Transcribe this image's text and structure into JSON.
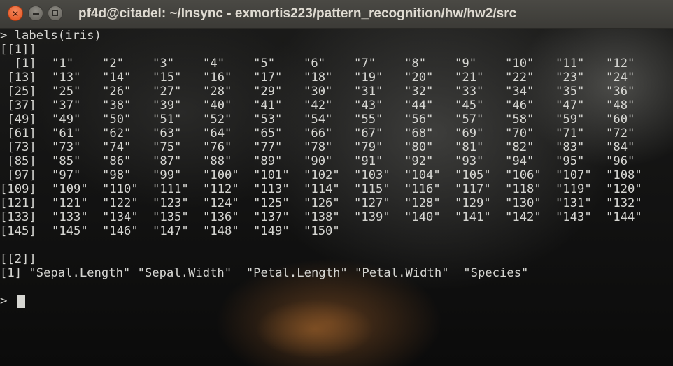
{
  "window": {
    "title": "pf4d@citadel: ~/Insync - exmortis223/pattern_recognition/hw/hw2/src",
    "close_glyph": "✕"
  },
  "terminal": {
    "command_line": "> labels(iris)",
    "section1_header": "[[1]]",
    "rows": [
      [
        "  [1]",
        "\"1\"",
        "\"2\"",
        "\"3\"",
        "\"4\"",
        "\"5\"",
        "\"6\"",
        "\"7\"",
        "\"8\"",
        "\"9\"",
        "\"10\"",
        "\"11\"",
        "\"12\""
      ],
      [
        " [13]",
        "\"13\"",
        "\"14\"",
        "\"15\"",
        "\"16\"",
        "\"17\"",
        "\"18\"",
        "\"19\"",
        "\"20\"",
        "\"21\"",
        "\"22\"",
        "\"23\"",
        "\"24\""
      ],
      [
        " [25]",
        "\"25\"",
        "\"26\"",
        "\"27\"",
        "\"28\"",
        "\"29\"",
        "\"30\"",
        "\"31\"",
        "\"32\"",
        "\"33\"",
        "\"34\"",
        "\"35\"",
        "\"36\""
      ],
      [
        " [37]",
        "\"37\"",
        "\"38\"",
        "\"39\"",
        "\"40\"",
        "\"41\"",
        "\"42\"",
        "\"43\"",
        "\"44\"",
        "\"45\"",
        "\"46\"",
        "\"47\"",
        "\"48\""
      ],
      [
        " [49]",
        "\"49\"",
        "\"50\"",
        "\"51\"",
        "\"52\"",
        "\"53\"",
        "\"54\"",
        "\"55\"",
        "\"56\"",
        "\"57\"",
        "\"58\"",
        "\"59\"",
        "\"60\""
      ],
      [
        " [61]",
        "\"61\"",
        "\"62\"",
        "\"63\"",
        "\"64\"",
        "\"65\"",
        "\"66\"",
        "\"67\"",
        "\"68\"",
        "\"69\"",
        "\"70\"",
        "\"71\"",
        "\"72\""
      ],
      [
        " [73]",
        "\"73\"",
        "\"74\"",
        "\"75\"",
        "\"76\"",
        "\"77\"",
        "\"78\"",
        "\"79\"",
        "\"80\"",
        "\"81\"",
        "\"82\"",
        "\"83\"",
        "\"84\""
      ],
      [
        " [85]",
        "\"85\"",
        "\"86\"",
        "\"87\"",
        "\"88\"",
        "\"89\"",
        "\"90\"",
        "\"91\"",
        "\"92\"",
        "\"93\"",
        "\"94\"",
        "\"95\"",
        "\"96\""
      ],
      [
        " [97]",
        "\"97\"",
        "\"98\"",
        "\"99\"",
        "\"100\"",
        "\"101\"",
        "\"102\"",
        "\"103\"",
        "\"104\"",
        "\"105\"",
        "\"106\"",
        "\"107\"",
        "\"108\""
      ],
      [
        "[109]",
        "\"109\"",
        "\"110\"",
        "\"111\"",
        "\"112\"",
        "\"113\"",
        "\"114\"",
        "\"115\"",
        "\"116\"",
        "\"117\"",
        "\"118\"",
        "\"119\"",
        "\"120\""
      ],
      [
        "[121]",
        "\"121\"",
        "\"122\"",
        "\"123\"",
        "\"124\"",
        "\"125\"",
        "\"126\"",
        "\"127\"",
        "\"128\"",
        "\"129\"",
        "\"130\"",
        "\"131\"",
        "\"132\""
      ],
      [
        "[133]",
        "\"133\"",
        "\"134\"",
        "\"135\"",
        "\"136\"",
        "\"137\"",
        "\"138\"",
        "\"139\"",
        "\"140\"",
        "\"141\"",
        "\"142\"",
        "\"143\"",
        "\"144\""
      ],
      [
        "[145]",
        "\"145\"",
        "\"146\"",
        "\"147\"",
        "\"148\"",
        "\"149\"",
        "\"150\""
      ]
    ],
    "section2_header": "[[2]]",
    "section2_line": "[1] \"Sepal.Length\" \"Sepal.Width\"  \"Petal.Length\" \"Petal.Width\"  \"Species\"",
    "prompt": ">"
  }
}
